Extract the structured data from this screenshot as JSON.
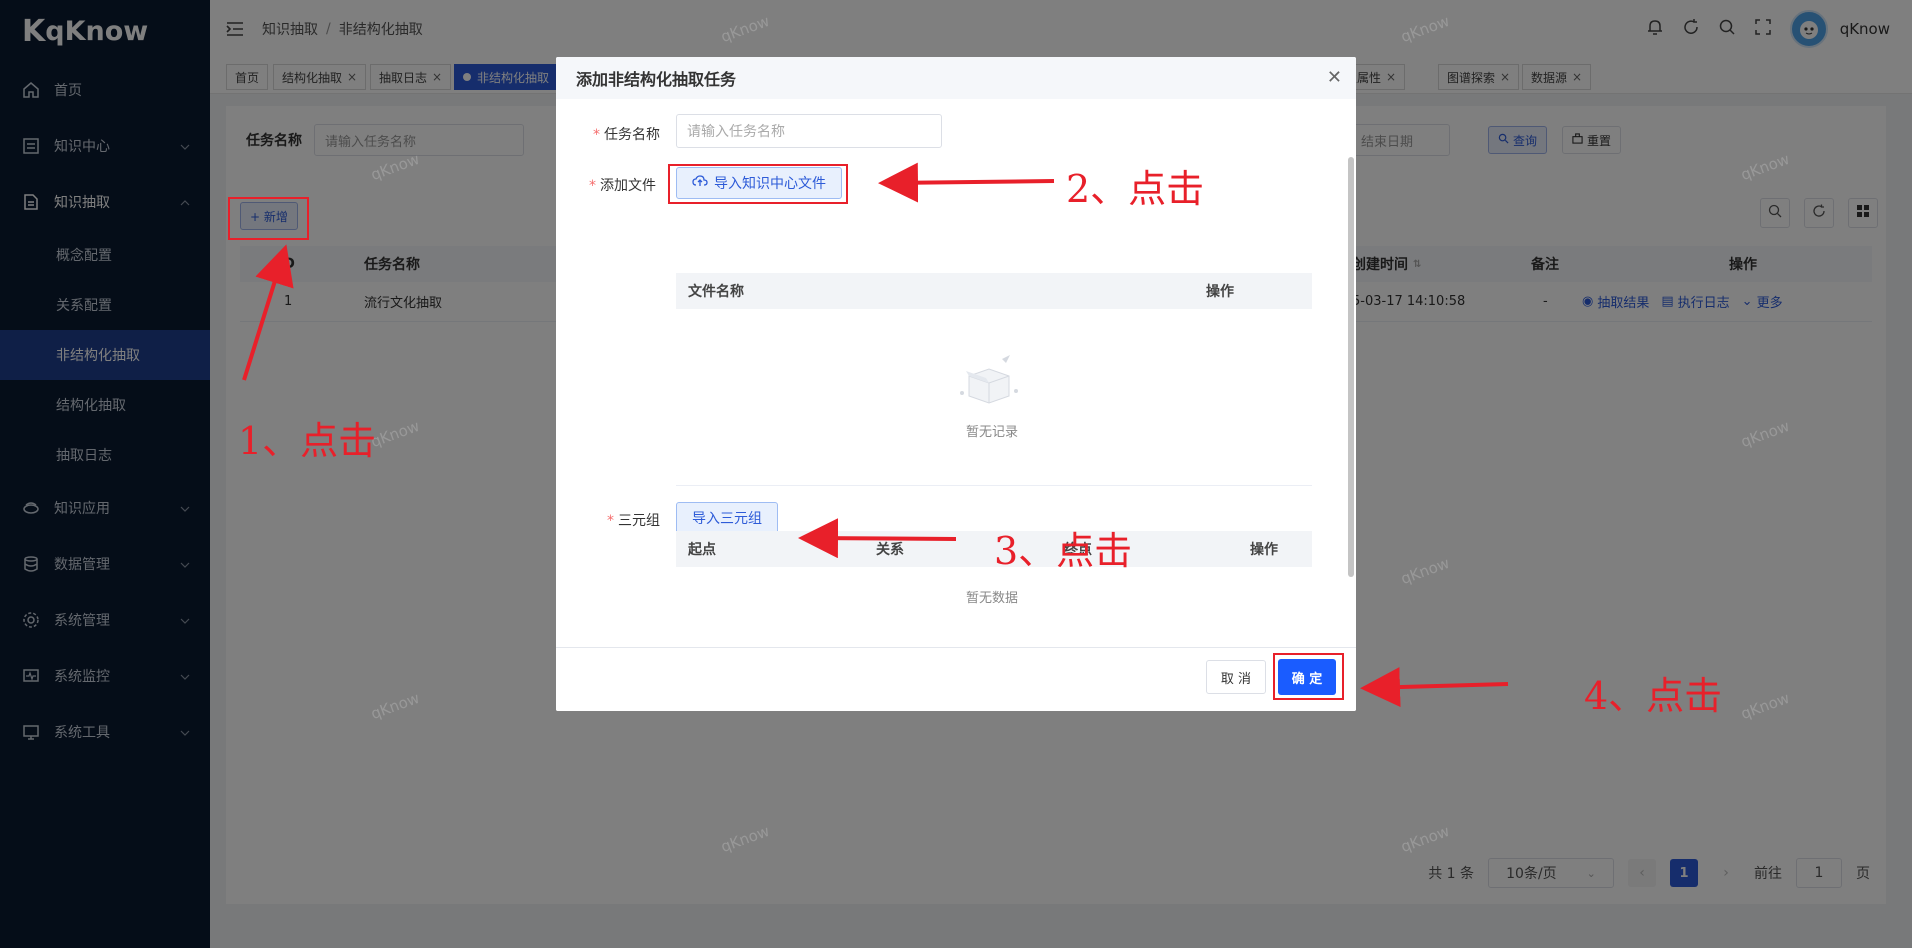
{
  "logo": {
    "mark": "K",
    "name": "qKnow"
  },
  "sidebar": {
    "items": [
      {
        "label": "首页",
        "icon": "home-icon"
      },
      {
        "label": "知识中心",
        "icon": "document-icon",
        "expandable": true
      },
      {
        "label": "知识抽取",
        "icon": "extract-icon",
        "expanded": true
      }
    ],
    "subitems": [
      {
        "label": "概念配置"
      },
      {
        "label": "关系配置"
      },
      {
        "label": "非结构化抽取",
        "active": true
      },
      {
        "label": "结构化抽取"
      },
      {
        "label": "抽取日志"
      }
    ],
    "items_after": [
      {
        "label": "知识应用",
        "icon": "app-icon"
      },
      {
        "label": "数据管理",
        "icon": "database-icon"
      },
      {
        "label": "系统管理",
        "icon": "settings-icon"
      },
      {
        "label": "系统监控",
        "icon": "monitor-icon"
      },
      {
        "label": "系统工具",
        "icon": "tools-icon"
      }
    ]
  },
  "header": {
    "breadcrumb": [
      "知识抽取",
      "非结构化抽取"
    ],
    "username": "qKnow"
  },
  "tags": [
    {
      "label": "首页",
      "closable": false
    },
    {
      "label": "结构化抽取",
      "closable": true
    },
    {
      "label": "抽取日志",
      "closable": true
    },
    {
      "label": "非结构化抽取",
      "active": true
    },
    {
      "label": "配置属性",
      "closable": true
    },
    {
      "label": "图谱探索",
      "closable": true
    },
    {
      "label": "数据源",
      "closable": true
    }
  ],
  "search": {
    "task_label": "任务名称",
    "task_placeholder": "请输入任务名称",
    "end_date_placeholder": "结束日期",
    "query_label": "查询",
    "reset_label": "重置"
  },
  "toolbar": {
    "add_label": "+ 新增"
  },
  "table": {
    "headers": {
      "id": "ID",
      "name": "任务名称",
      "created": "创建时间",
      "remark": "备注",
      "ops": "操作"
    },
    "rows": [
      {
        "id": "1",
        "name": "流行文化抽取",
        "created": "5-03-17 14:10:58",
        "remark": "-"
      }
    ],
    "ops": {
      "result": "抽取结果",
      "log": "执行日志",
      "more": "更多"
    }
  },
  "pager": {
    "total": "共 1 条",
    "page_size": "10条/页",
    "current": "1",
    "goto_label": "前往",
    "goto_value": "1",
    "page_suffix": "页"
  },
  "dialog": {
    "title": "添加非结构化抽取任务",
    "name_label": "任务名称",
    "name_placeholder": "请输入任务名称",
    "file_label": "添加文件",
    "import_file_label": "导入知识中心文件",
    "file_table_headers": {
      "name": "文件名称",
      "ops": "操作"
    },
    "file_empty": "暂无记录",
    "triple_label": "三元组",
    "import_triple_label": "导入三元组",
    "triple_table_headers": {
      "start": "起点",
      "relation": "关系",
      "end": "终点",
      "ops": "操作"
    },
    "triple_empty": "暂无数据",
    "cancel_label": "取 消",
    "ok_label": "确 定"
  },
  "annotations": {
    "step1": "1、点击",
    "step2": "2、点击",
    "step3": "3、点击",
    "step4": "4、点击"
  },
  "watermark": "qKnow",
  "colors": {
    "accent": "#2d5bd8",
    "sidebar_bg": "#0b1a30",
    "annotation": "#e8202a",
    "primary_button": "#1a5cff"
  }
}
